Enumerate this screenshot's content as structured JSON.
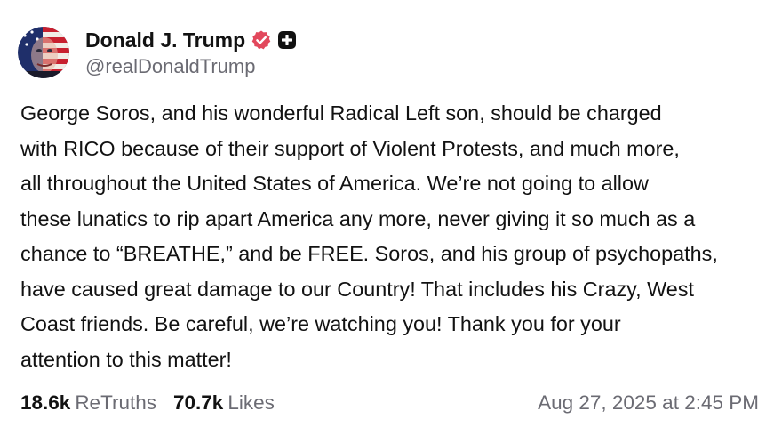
{
  "author": {
    "display_name": "Donald J. Trump",
    "handle": "@realDonaldTrump",
    "avatar_icon": "flag-face-avatar",
    "verified_icon": "verified-badge-icon",
    "plus_icon": "truth-plus-icon"
  },
  "post": {
    "lines": [
      "George Soros, and his wonderful Radical Left son, should be charged",
      "with RICO because of their support of Violent Protests, and much more,",
      "all throughout the United States of America. We’re not going to allow",
      "these lunatics to rip apart America any more, never giving it so much as a",
      "chance to “BREATHE,” and be FREE. Soros, and his group of psychopaths,",
      "have caused great damage to our Country! That includes his Crazy, West",
      "Coast friends. Be careful, we’re watching you! Thank you for your",
      "attention to this matter!"
    ]
  },
  "stats": {
    "retruths_count": "18.6k",
    "retruths_label": "ReTruths",
    "likes_count": "70.7k",
    "likes_label": "Likes"
  },
  "timestamp": "Aug 27, 2025 at 2:45 PM",
  "colors": {
    "text": "#121212",
    "muted": "#6b6b73",
    "verified": "#e2485c",
    "background": "#ffffff"
  }
}
